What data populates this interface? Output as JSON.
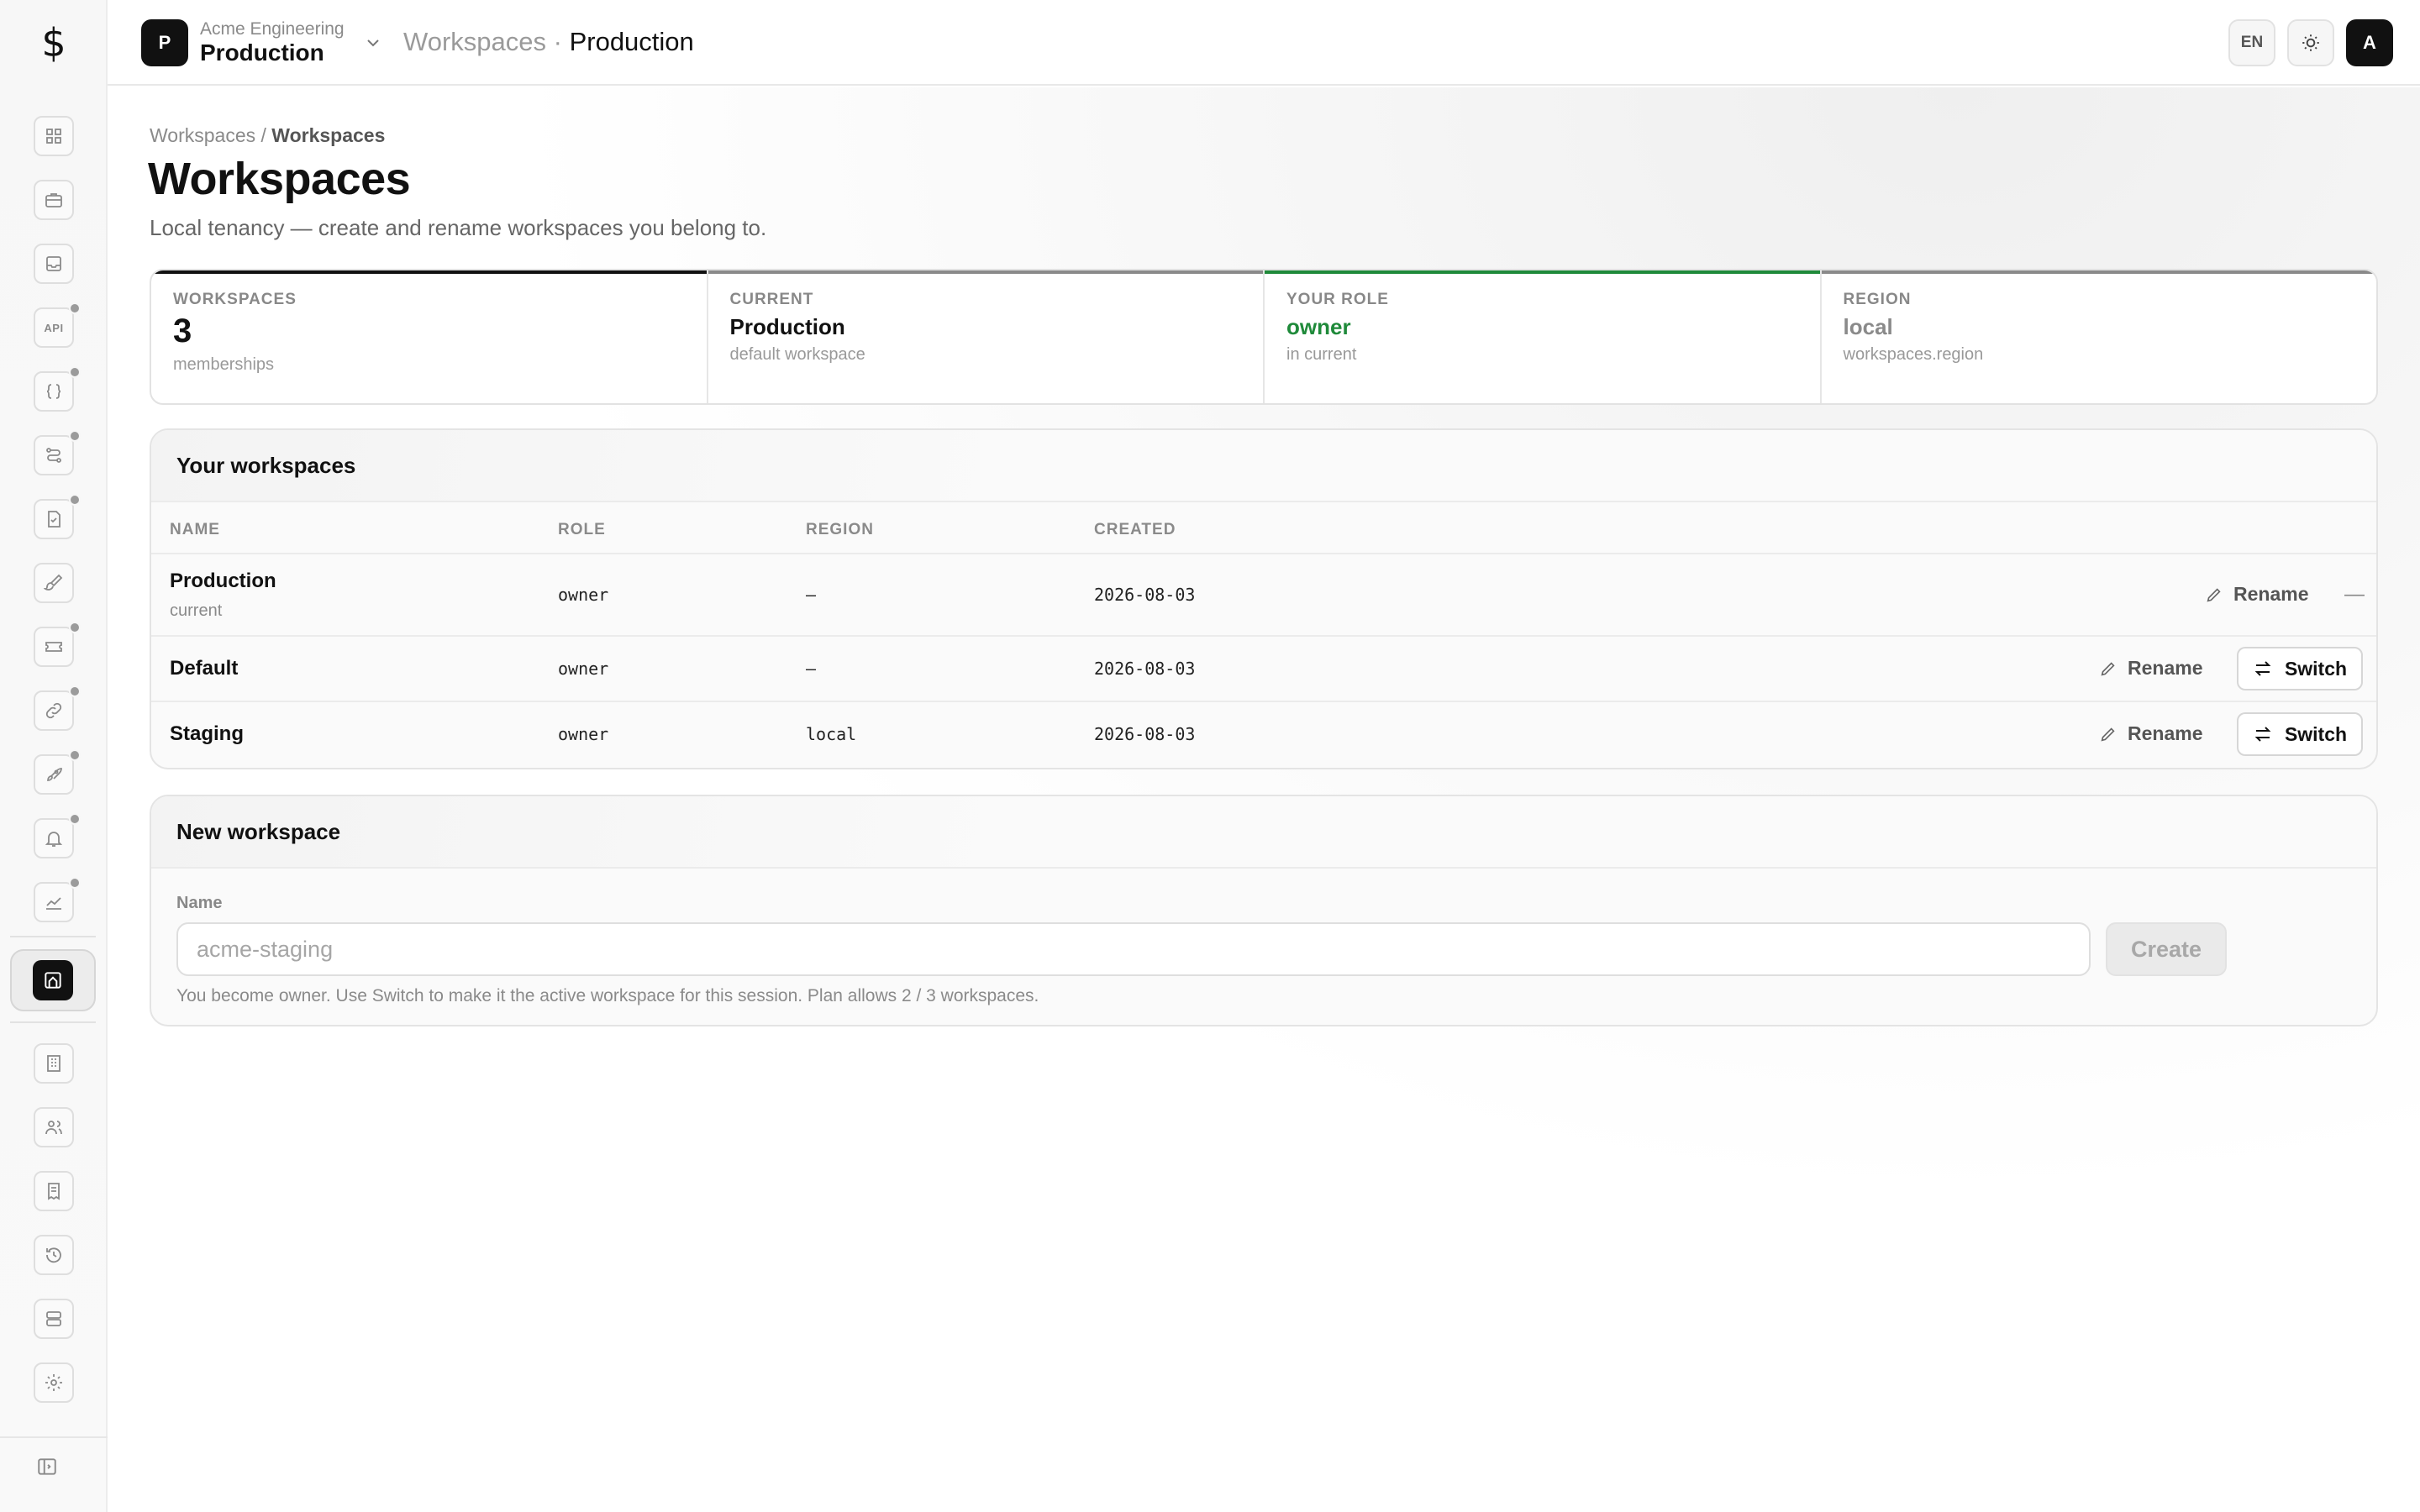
{
  "sidebar": {
    "logo": "$",
    "icons": [
      {
        "name": "dashboard-icon",
        "dot": false
      },
      {
        "name": "briefcase-icon",
        "dot": false
      },
      {
        "name": "inbox-icon",
        "dot": false
      },
      {
        "name": "api-icon",
        "dot": true,
        "label": "API"
      },
      {
        "name": "braces-icon",
        "dot": true
      },
      {
        "name": "flow-icon",
        "dot": true
      },
      {
        "name": "document-check-icon",
        "dot": true
      },
      {
        "name": "brush-icon",
        "dot": false
      },
      {
        "name": "ticket-icon",
        "dot": true
      },
      {
        "name": "link-icon",
        "dot": true
      },
      {
        "name": "rocket-icon",
        "dot": true
      },
      {
        "name": "bell-icon",
        "dot": true
      },
      {
        "name": "chart-icon",
        "dot": true
      }
    ],
    "active_icon": "workspace-icon",
    "bottom_icons": [
      "building-icon",
      "users-icon",
      "receipt-icon",
      "history-icon",
      "storage-icon",
      "settings-icon"
    ],
    "collapse_icon": "sidebar-collapse-icon"
  },
  "topbar": {
    "workspace_initial": "P",
    "org_name": "Acme Engineering",
    "workspace_name": "Production",
    "crumb_section": "Workspaces",
    "crumb_sep": "·",
    "crumb_current": "Production",
    "lang": "EN",
    "user_initial": "A"
  },
  "page": {
    "breadcrumb_root": "Workspaces",
    "breadcrumb_sep": "/",
    "breadcrumb_current": "Workspaces",
    "title": "Workspaces",
    "subtitle": "Local tenancy — create and rename workspaces you belong to."
  },
  "stats": [
    {
      "label": "WORKSPACES",
      "value": "3",
      "hint": "memberships",
      "accent": "#111111"
    },
    {
      "label": "CURRENT",
      "value": "Production",
      "hint": "default workspace",
      "accent": "#8a8a8a"
    },
    {
      "label": "YOUR ROLE",
      "value": "owner",
      "hint": "in current",
      "accent": "#1f8a3a"
    },
    {
      "label": "REGION",
      "value": "local",
      "hint": "workspaces.region",
      "accent": "#8a8a8a"
    }
  ],
  "workspaces_card": {
    "title": "Your workspaces",
    "columns": [
      "NAME",
      "ROLE",
      "REGION",
      "CREATED"
    ],
    "rows": [
      {
        "name": "Production",
        "sub": "current",
        "role": "owner",
        "region": "—",
        "created": "2026-08-03",
        "rename": "Rename",
        "action": "—"
      },
      {
        "name": "Default",
        "role": "owner",
        "region": "—",
        "created": "2026-08-03",
        "rename": "Rename",
        "action": "Switch"
      },
      {
        "name": "Staging",
        "role": "owner",
        "region": "local",
        "created": "2026-08-03",
        "rename": "Rename",
        "action": "Switch"
      }
    ]
  },
  "new_workspace": {
    "title": "New workspace",
    "field_label": "Name",
    "placeholder": "acme-staging",
    "value": "",
    "button": "Create",
    "hint": "You become owner. Use Switch to make it the active workspace for this session. Plan allows 2 / 3 workspaces."
  },
  "colors": {
    "accent_green": "#1f8a3a",
    "ink": "#111111"
  }
}
